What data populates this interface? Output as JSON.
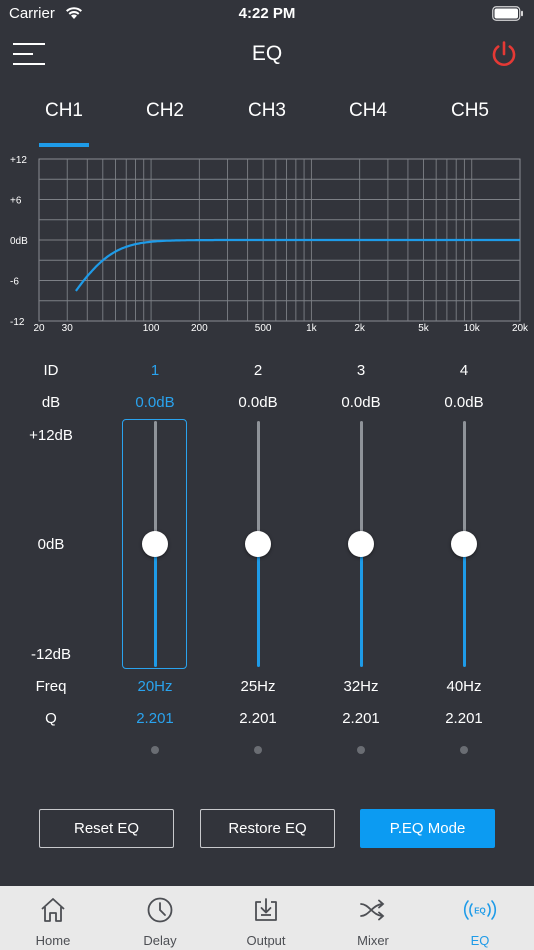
{
  "status_bar": {
    "carrier": "Carrier",
    "time": "4:22 PM"
  },
  "header": {
    "title": "EQ"
  },
  "tabs": [
    {
      "label": "CH1",
      "active": true
    },
    {
      "label": "CH2",
      "active": false
    },
    {
      "label": "CH3",
      "active": false
    },
    {
      "label": "CH4",
      "active": false
    },
    {
      "label": "CH5",
      "active": false
    }
  ],
  "graph": {
    "y_ticks": [
      "+12",
      "+6",
      "0dB",
      "-6",
      "-12"
    ],
    "x_ticks": [
      "20",
      "30",
      "100",
      "200",
      "500",
      "1k",
      "2k",
      "5k",
      "10k",
      "20k"
    ],
    "x_tick_values": [
      20,
      30,
      100,
      200,
      500,
      1000,
      2000,
      5000,
      10000,
      20000
    ],
    "y_range": [
      -12,
      12
    ],
    "x_range": [
      20,
      20000
    ],
    "curve_color": "#1e9be8"
  },
  "eq": {
    "labels": {
      "id": "ID",
      "db": "dB",
      "top": "+12dB",
      "mid": "0dB",
      "bottom": "-12dB",
      "freq": "Freq",
      "q": "Q"
    },
    "bands": [
      {
        "id": "1",
        "db": "0.0dB",
        "freq": "20Hz",
        "q": "2.201",
        "level": 0.5,
        "selected": true
      },
      {
        "id": "2",
        "db": "0.0dB",
        "freq": "25Hz",
        "q": "2.201",
        "level": 0.5,
        "selected": false
      },
      {
        "id": "3",
        "db": "0.0dB",
        "freq": "32Hz",
        "q": "2.201",
        "level": 0.5,
        "selected": false
      },
      {
        "id": "4",
        "db": "0.0dB",
        "freq": "40Hz",
        "q": "2.201",
        "level": 0.5,
        "selected": false
      }
    ]
  },
  "buttons": {
    "reset": "Reset EQ",
    "restore": "Restore EQ",
    "mode": "P.EQ Mode"
  },
  "nav": [
    {
      "label": "Home",
      "icon": "home-icon",
      "active": false
    },
    {
      "label": "Delay",
      "icon": "clock-icon",
      "active": false
    },
    {
      "label": "Output",
      "icon": "output-icon",
      "active": false
    },
    {
      "label": "Mixer",
      "icon": "shuffle-icon",
      "active": false
    },
    {
      "label": "EQ",
      "icon": "eq-icon",
      "active": true
    }
  ],
  "colors": {
    "accent": "#1e9be8",
    "background": "#32343b",
    "power": "#e53935"
  }
}
